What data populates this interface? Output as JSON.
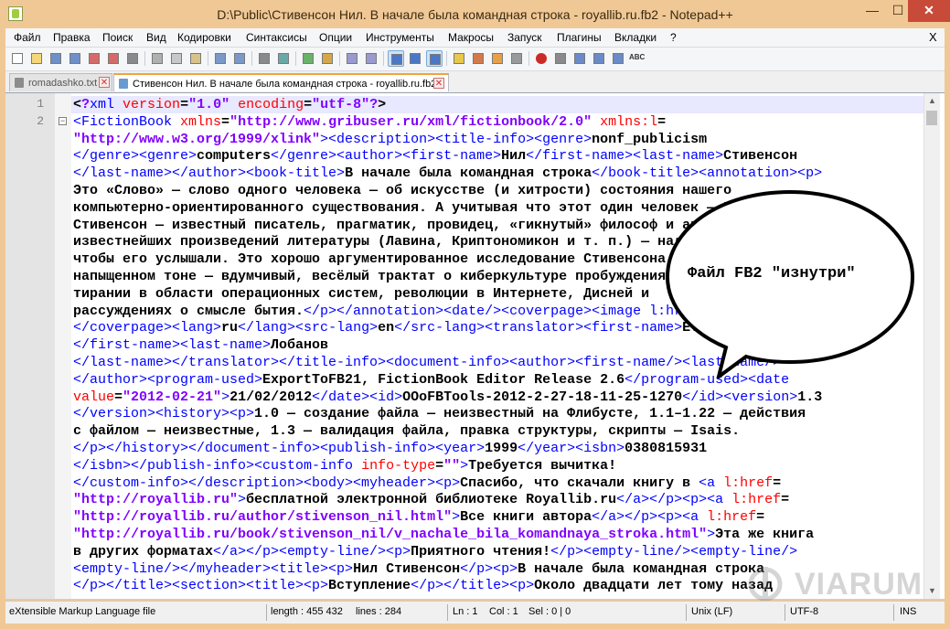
{
  "window": {
    "title": "D:\\Public\\Стивенсон Нил. В начале была командная строка - royallib.ru.fb2 - Notepad++",
    "minimize_glyph": "—",
    "maximize_glyph": "☐",
    "close_glyph": "✕"
  },
  "menu": {
    "items": [
      "Файл",
      "Правка",
      "Поиск",
      "Вид",
      "Кодировки",
      "Синтаксисы",
      "Опции",
      "Инструменты",
      "Макросы",
      "Запуск",
      "Плагины",
      "Вкладки",
      "?"
    ],
    "close_glyph": "X"
  },
  "toolbar": {
    "buttons": [
      "new-file-icon",
      "open-file-icon",
      "save-icon",
      "save-all-icon",
      "close-icon",
      "close-all-icon",
      "print-icon",
      "cut-icon",
      "copy-icon",
      "paste-icon",
      "undo-icon",
      "redo-icon",
      "find-icon",
      "replace-icon",
      "zoom-in-icon",
      "zoom-out-icon",
      "sync-vertical-icon",
      "sync-horizontal-icon",
      "word-wrap-icon",
      "show-all-chars-icon",
      "indent-guide-icon",
      "document-map-icon",
      "function-list-icon",
      "folder-as-workspace-icon",
      "monitoring-icon",
      "record-macro-icon",
      "stop-macro-icon",
      "play-macro-icon",
      "run-macro-multiple-icon",
      "save-macro-icon",
      "spell-check-icon"
    ],
    "spell_label": "ABC"
  },
  "tabs": [
    {
      "label": "romadashko.txt",
      "active": false
    },
    {
      "label": "Стивенсон Нил. В начале была командная строка - royallib.ru.fb2",
      "active": true
    }
  ],
  "editor": {
    "line_numbers": [
      "1",
      "2"
    ],
    "fold_glyph": "−",
    "lines": [
      [
        [
          "p",
          "<"
        ],
        [
          "s",
          "?"
        ],
        [
          "t",
          "xml"
        ],
        [
          "a",
          " version"
        ],
        [
          "p",
          "="
        ],
        [
          "s",
          "\"1.0\""
        ],
        [
          "a",
          " encoding"
        ],
        [
          "p",
          "="
        ],
        [
          "s",
          "\"utf-8\""
        ],
        [
          "s",
          "?"
        ],
        [
          "p",
          ">"
        ]
      ],
      [
        [
          "t",
          "<FictionBook"
        ],
        [
          "a",
          " xmlns"
        ],
        [
          "p",
          "="
        ],
        [
          "s",
          "\"http://www.gribuser.ru/xml/fictionbook/2.0\""
        ],
        [
          "a",
          " xmlns:l"
        ],
        [
          "p",
          "="
        ]
      ],
      [
        [
          "s",
          "\"http://www.w3.org/1999/xlink\""
        ],
        [
          "t",
          "><description><title-info><genre>"
        ],
        [
          "p",
          "nonf_publicism"
        ]
      ],
      [
        [
          "t",
          "</genre><genre>"
        ],
        [
          "p",
          "computers"
        ],
        [
          "t",
          "</genre><author><first-name>"
        ],
        [
          "p",
          "Нил"
        ],
        [
          "t",
          "</first-name><last-name>"
        ],
        [
          "p",
          "Стивенсон"
        ]
      ],
      [
        [
          "t",
          "</last-name></author><book-title>"
        ],
        [
          "p",
          "В начале была командная строка"
        ],
        [
          "t",
          "</book-title><annotation><p>"
        ]
      ],
      [
        [
          "p",
          "Это «Слово» — слово одного человека — об искусстве (и хитрости) состояния нашего"
        ]
      ],
      [
        [
          "p",
          "компьютерно-ориентированного существования. А учитывая что этот один человек — Нил"
        ]
      ],
      [
        [
          "p",
          "Стивенсон — известный писатель, прагматик, провидец, «гикнутый» философ и автор"
        ]
      ],
      [
        [
          "p",
          "известнейших произведений литературы (Лавина, Криптономикон и т. п.) — надо слушать,"
        ]
      ],
      [
        [
          "p",
          "чтобы его услышали. Это хорошо аргументированное исследование Стивенсона в"
        ]
      ],
      [
        [
          "p",
          "напыщенном тоне — вдумчивый, весёлый трактат о киберкультуре пробуждения и"
        ]
      ],
      [
        [
          "p",
          "тирании в области операционных систем, революции в Интернете, Дисней и"
        ]
      ],
      [
        [
          "p",
          "рассуждениях о смысле бытия."
        ],
        [
          "t",
          "</p></annotation><date/><coverpage><image l:href=\"#cover.jpg\"/>"
        ]
      ],
      [
        [
          "t",
          "</coverpage><lang>"
        ],
        [
          "p",
          "ru"
        ],
        [
          "t",
          "</lang><src-lang>"
        ],
        [
          "p",
          "en"
        ],
        [
          "t",
          "</src-lang><translator><first-name>"
        ],
        [
          "p",
          "Е."
        ]
      ],
      [
        [
          "t",
          "</first-name><last-name>"
        ],
        [
          "p",
          "Лобанов"
        ]
      ],
      [
        [
          "t",
          "</last-name></translator></title-info><document-info><author><first-name/><last-name/>"
        ]
      ],
      [
        [
          "t",
          "</author><program-used>"
        ],
        [
          "p",
          "ExportToFB21, FictionBook Editor Release 2.6"
        ],
        [
          "t",
          "</program-used><date"
        ]
      ],
      [
        [
          "a",
          "value"
        ],
        [
          "p",
          "="
        ],
        [
          "s",
          "\"2012-02-21\""
        ],
        [
          "t",
          ">"
        ],
        [
          "p",
          "21/02/2012"
        ],
        [
          "t",
          "</date><id>"
        ],
        [
          "p",
          "OOoFBTools-2012-2-27-18-11-25-1270"
        ],
        [
          "t",
          "</id><version>"
        ],
        [
          "p",
          "1.3"
        ]
      ],
      [
        [
          "t",
          "</version><history><p>"
        ],
        [
          "p",
          "1.0 — создание файла — неизвестный на Флибусте, 1.1–1.22 — действия"
        ]
      ],
      [
        [
          "p",
          "с файлом — неизвестные, 1.3 — валидация файла, правка структуры, скрипты — Isais."
        ]
      ],
      [
        [
          "t",
          "</p></history></document-info><publish-info><year>"
        ],
        [
          "p",
          "1999"
        ],
        [
          "t",
          "</year><isbn>"
        ],
        [
          "p",
          "0380815931"
        ]
      ],
      [
        [
          "t",
          "</isbn></publish-info><custom-info"
        ],
        [
          "a",
          " info-type"
        ],
        [
          "p",
          "="
        ],
        [
          "s",
          "\"\""
        ],
        [
          "t",
          ">"
        ],
        [
          "p",
          "Требуется вычитка!"
        ]
      ],
      [
        [
          "t",
          "</custom-info></description><body><myheader><p>"
        ],
        [
          "p",
          "Спасибо, что скачали книгу в "
        ],
        [
          "t",
          "<a"
        ],
        [
          "a",
          " l:href"
        ],
        [
          "p",
          "="
        ]
      ],
      [
        [
          "s",
          "\"http://royallib.ru\""
        ],
        [
          "t",
          ">"
        ],
        [
          "p",
          "бесплатной электронной библиотеке Royallib.ru"
        ],
        [
          "t",
          "</a></p><p><a"
        ],
        [
          "a",
          " l:href"
        ],
        [
          "p",
          "="
        ]
      ],
      [
        [
          "s",
          "\"http://royallib.ru/author/stivenson_nil.html\""
        ],
        [
          "t",
          ">"
        ],
        [
          "p",
          "Все книги автора"
        ],
        [
          "t",
          "</a></p><p><a"
        ],
        [
          "a",
          " l:href"
        ],
        [
          "p",
          "="
        ]
      ],
      [
        [
          "s",
          "\"http://royallib.ru/book/stivenson_nil/v_nachale_bila_komandnaya_stroka.html\""
        ],
        [
          "t",
          ">"
        ],
        [
          "p",
          "Эта же книга"
        ]
      ],
      [
        [
          "p",
          "в других форматах"
        ],
        [
          "t",
          "</a></p><empty-line/><p>"
        ],
        [
          "p",
          "Приятного чтения!"
        ],
        [
          "t",
          "</p><empty-line/><empty-line/>"
        ]
      ],
      [
        [
          "t",
          "<empty-line/></myheader><title><p>"
        ],
        [
          "p",
          "Нил Стивенсон"
        ],
        [
          "t",
          "</p><p>"
        ],
        [
          "p",
          "В начале была командная строка"
        ]
      ],
      [
        [
          "t",
          "</p></title><section><title><p>"
        ],
        [
          "p",
          "Вступление"
        ],
        [
          "t",
          "</p></title><p>"
        ],
        [
          "p",
          "Около двадцати лет тому назад"
        ]
      ]
    ]
  },
  "callout": {
    "text": "Файл FB2 \"изнутри\""
  },
  "watermark": {
    "text": "VIARUM"
  },
  "status": {
    "file_type": "eXtensible Markup Language file",
    "length": "length : 455 432",
    "lines": "lines : 284",
    "ln": "Ln : 1",
    "col": "Col : 1",
    "sel": "Sel : 0 | 0",
    "eol": "Unix (LF)",
    "encoding": "UTF-8",
    "mode": "INS"
  },
  "colors": {
    "title_bar": "#f0c896",
    "close_button": "#c84a38",
    "tag": "#0000ff",
    "attribute": "#ff0000",
    "string": "#8000ff"
  }
}
